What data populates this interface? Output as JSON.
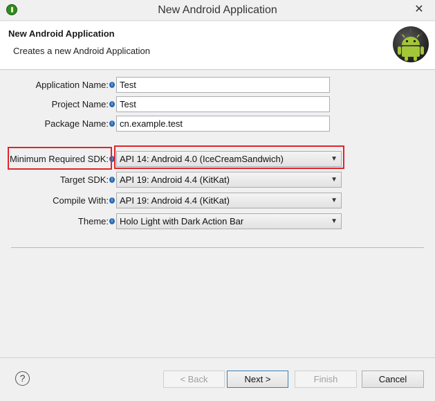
{
  "window": {
    "title": "New Android Application",
    "close_glyph": "✕"
  },
  "banner": {
    "title": "New Android Application",
    "description": "Creates a new Android Application"
  },
  "form": {
    "application_name": {
      "label": "Application Name:",
      "value": "Test"
    },
    "project_name": {
      "label": "Project Name:",
      "value": "Test"
    },
    "package_name": {
      "label": "Package Name:",
      "value": "cn.example.test"
    },
    "min_sdk": {
      "label": "Minimum Required SDK:",
      "value": "API 14: Android 4.0 (IceCreamSandwich)"
    },
    "target_sdk": {
      "label": "Target SDK:",
      "value": "API 19: Android 4.4 (KitKat)"
    },
    "compile_with": {
      "label": "Compile With:",
      "value": "API 19: Android 4.4 (KitKat)"
    },
    "theme": {
      "label": "Theme:",
      "value": "Holo Light with Dark Action Bar"
    }
  },
  "info_glyph": "i",
  "dropdown_glyph": "▼",
  "footer": {
    "help_glyph": "?",
    "back": "< Back",
    "next": "Next >",
    "finish": "Finish",
    "cancel": "Cancel"
  },
  "colors": {
    "highlight": "#e0242a",
    "android_green": "#8fc21c"
  },
  "icons": [
    "eclipse-adt-app-icon",
    "android-logo-icon",
    "info-icon",
    "help-icon",
    "dropdown-arrow-icon"
  ]
}
